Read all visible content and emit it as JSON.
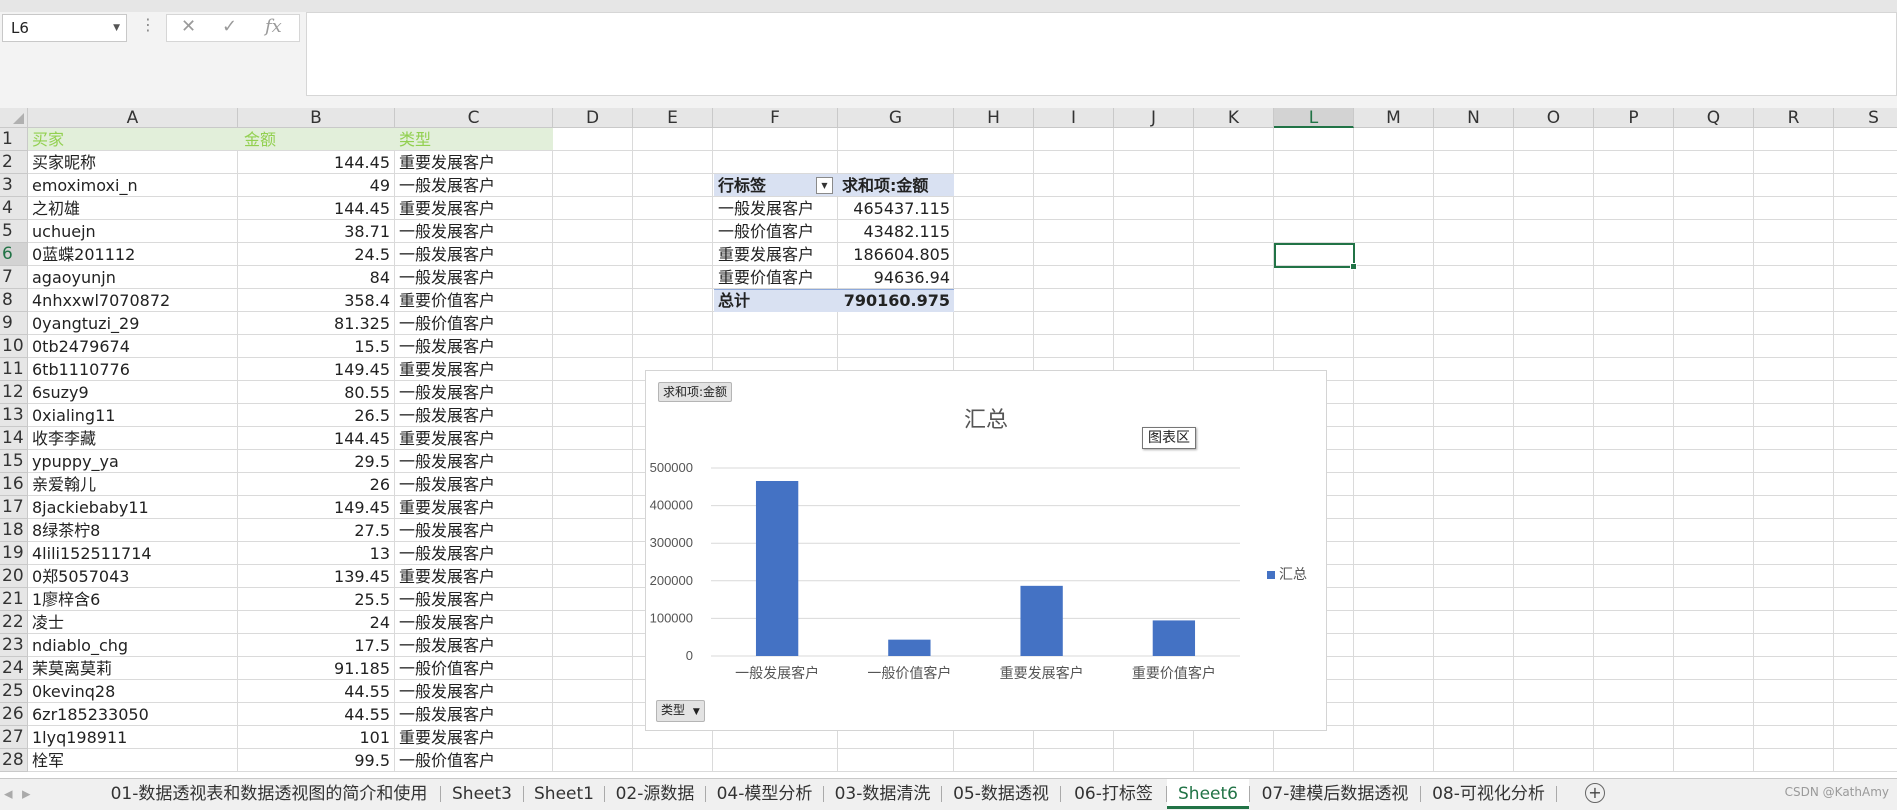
{
  "name_box": "L6",
  "formula_icons": [
    "cancel-icon",
    "enter-icon",
    "function-icon"
  ],
  "formula_fx": "fx",
  "columns": [
    "A",
    "B",
    "C",
    "D",
    "E",
    "F",
    "G",
    "H",
    "I",
    "J",
    "K",
    "L",
    "M",
    "N",
    "O",
    "P",
    "Q",
    "R",
    "S"
  ],
  "selected_column": "L",
  "rows": [
    "1",
    "2",
    "3",
    "4",
    "5",
    "6",
    "7",
    "8",
    "9",
    "10",
    "11",
    "12",
    "13",
    "14",
    "15",
    "16",
    "17",
    "18",
    "19",
    "20",
    "21",
    "22",
    "23",
    "24",
    "25",
    "26",
    "27",
    "28"
  ],
  "selected_row": "6",
  "header_row": {
    "a": "买家",
    "b": "金额",
    "c": "类型"
  },
  "data_rows": [
    {
      "a": "买家昵称",
      "b": "144.45",
      "c": "重要发展客户"
    },
    {
      "a": "emoximoxi_n",
      "b": "49",
      "c": "一般发展客户"
    },
    {
      "a": "之初雄",
      "b": "144.45",
      "c": "重要发展客户"
    },
    {
      "a": "uchuejn",
      "b": "38.71",
      "c": "一般发展客户"
    },
    {
      "a": "0蓝蝶201112",
      "b": "24.5",
      "c": "一般发展客户"
    },
    {
      "a": "agaoyunjn",
      "b": "84",
      "c": "一般发展客户"
    },
    {
      "a": "4nhxxwl7070872",
      "b": "358.4",
      "c": "重要价值客户"
    },
    {
      "a": "0yangtuzi_29",
      "b": "81.325",
      "c": "一般价值客户"
    },
    {
      "a": "0tb2479674",
      "b": "15.5",
      "c": "一般发展客户"
    },
    {
      "a": "6tb1110776",
      "b": "149.45",
      "c": "重要发展客户"
    },
    {
      "a": "6suzy9",
      "b": "80.55",
      "c": "一般发展客户"
    },
    {
      "a": "0xialing11",
      "b": "26.5",
      "c": "一般发展客户"
    },
    {
      "a": "收李李藏",
      "b": "144.45",
      "c": "重要发展客户"
    },
    {
      "a": "ypuppy_ya",
      "b": "29.5",
      "c": "一般发展客户"
    },
    {
      "a": "亲爱翰儿",
      "b": "26",
      "c": "一般发展客户"
    },
    {
      "a": "8jackiebaby11",
      "b": "149.45",
      "c": "重要发展客户"
    },
    {
      "a": "8绿茶柠8",
      "b": "27.5",
      "c": "一般发展客户"
    },
    {
      "a": "4lili152511714",
      "b": "13",
      "c": "一般发展客户"
    },
    {
      "a": "0郑5057043",
      "b": "139.45",
      "c": "重要发展客户"
    },
    {
      "a": "1廖梓含6",
      "b": "25.5",
      "c": "一般发展客户"
    },
    {
      "a": "凌士",
      "b": "24",
      "c": "一般发展客户"
    },
    {
      "a": "ndiablo_chg",
      "b": "17.5",
      "c": "一般发展客户"
    },
    {
      "a": "茉莫离莫莉",
      "b": "91.185",
      "c": "一般价值客户"
    },
    {
      "a": "0kevinq28",
      "b": "44.55",
      "c": "一般发展客户"
    },
    {
      "a": "6zr185233050",
      "b": "44.55",
      "c": "一般发展客户"
    },
    {
      "a": "1lyq198911",
      "b": "101",
      "c": "重要发展客户"
    },
    {
      "a": "栓军",
      "b": "99.5",
      "c": "一般价值客户"
    }
  ],
  "pivot": {
    "row_label_header": "行标签",
    "value_header": "求和项:金额",
    "rows": [
      {
        "label": "一般发展客户",
        "value": "465437.115"
      },
      {
        "label": "一般价值客户",
        "value": "43482.115"
      },
      {
        "label": "重要发展客户",
        "value": "186604.805"
      },
      {
        "label": "重要价值客户",
        "value": "94636.94"
      }
    ],
    "total_label": "总计",
    "total_value": "790160.975"
  },
  "chart_field_button": "求和项:金额",
  "chart_axis_field_button": "类型",
  "chart_tooltip": "图表区",
  "chart_data": {
    "type": "bar",
    "title": "汇总",
    "categories": [
      "一般发展客户",
      "一般价值客户",
      "重要发展客户",
      "重要价值客户"
    ],
    "series": [
      {
        "name": "汇总",
        "values": [
          465437.115,
          43482.115,
          186604.805,
          94636.94
        ],
        "color": "#4472c4"
      }
    ],
    "ylim": [
      0,
      500000
    ],
    "yticks": [
      "0",
      "100000",
      "200000",
      "300000",
      "400000",
      "500000"
    ],
    "grid": true,
    "legend": "right"
  },
  "sheet_tabs": [
    "01-数据透视表和数据透视图的简介和使用",
    "Sheet3",
    "Sheet1",
    "02-源数据",
    "04-模型分析",
    "03-数据清洗",
    "05-数据透视",
    "06-打标签",
    "Sheet6",
    "07-建模后数据透视",
    "08-可视化分析"
  ],
  "active_tab": "Sheet6",
  "watermark": "CSDN @KathAmy"
}
